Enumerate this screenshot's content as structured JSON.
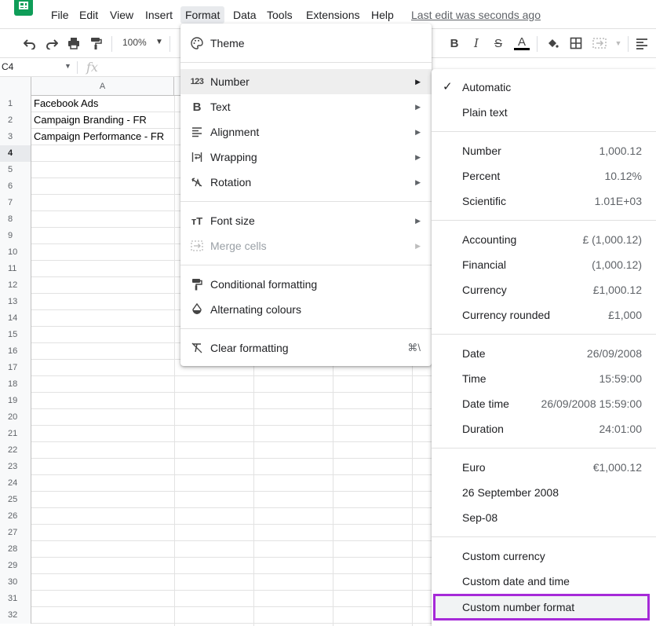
{
  "menubar": {
    "items": [
      "File",
      "Edit",
      "View",
      "Insert",
      "Format",
      "Data",
      "Tools",
      "Extensions",
      "Help"
    ],
    "active": "Format",
    "last_edit": "Last edit was seconds ago"
  },
  "toolbar": {
    "zoom": "100%",
    "icons": [
      "undo-icon",
      "redo-icon",
      "print-icon",
      "paint-format-icon",
      "bold-icon",
      "italic-icon",
      "strikethrough-icon",
      "text-color-icon",
      "fill-color-icon",
      "borders-icon",
      "merge-cells-icon",
      "align-icon"
    ]
  },
  "formula": {
    "namebox": "C4",
    "fx": "fx"
  },
  "sheet": {
    "columns": [
      "A"
    ],
    "rows": [
      "1",
      "2",
      "3",
      "4",
      "5",
      "6",
      "7",
      "8",
      "9",
      "10",
      "11",
      "12",
      "13",
      "14",
      "15",
      "16",
      "17",
      "18",
      "19",
      "20",
      "21",
      "22",
      "23",
      "24",
      "25",
      "26",
      "27",
      "28",
      "29",
      "30",
      "31",
      "32"
    ],
    "cells_a": [
      "Facebook Ads",
      "Campaign Branding - FR",
      "Campaign Performance - FR"
    ],
    "selected_row": "4"
  },
  "format_menu": {
    "theme": "Theme",
    "number": "Number",
    "text": "Text",
    "alignment": "Alignment",
    "wrapping": "Wrapping",
    "rotation": "Rotation",
    "font_size": "Font size",
    "merge_cells": "Merge cells",
    "conditional": "Conditional formatting",
    "alternating": "Alternating colours",
    "clear": "Clear formatting",
    "clear_shortcut": "⌘\\"
  },
  "number_menu": {
    "automatic": "Automatic",
    "plain_text": "Plain text",
    "number": {
      "label": "Number",
      "value": "1,000.12"
    },
    "percent": {
      "label": "Percent",
      "value": "10.12%"
    },
    "scientific": {
      "label": "Scientific",
      "value": "1.01E+03"
    },
    "accounting": {
      "label": "Accounting",
      "value": "£ (1,000.12)"
    },
    "financial": {
      "label": "Financial",
      "value": "(1,000.12)"
    },
    "currency": {
      "label": "Currency",
      "value": "£1,000.12"
    },
    "currency_rounded": {
      "label": "Currency rounded",
      "value": "£1,000"
    },
    "date": {
      "label": "Date",
      "value": "26/09/2008"
    },
    "time": {
      "label": "Time",
      "value": "15:59:00"
    },
    "date_time": {
      "label": "Date time",
      "value": "26/09/2008 15:59:00"
    },
    "duration": {
      "label": "Duration",
      "value": "24:01:00"
    },
    "euro": {
      "label": "Euro",
      "value": "€1,000.12"
    },
    "long_date": "26 September 2008",
    "short_month": "Sep-08",
    "custom_currency": "Custom currency",
    "custom_date_time": "Custom date and time",
    "custom_number": "Custom number format"
  },
  "colors": {
    "highlight_outline": "#a62ad8",
    "sheets_green": "#0f9d58"
  }
}
